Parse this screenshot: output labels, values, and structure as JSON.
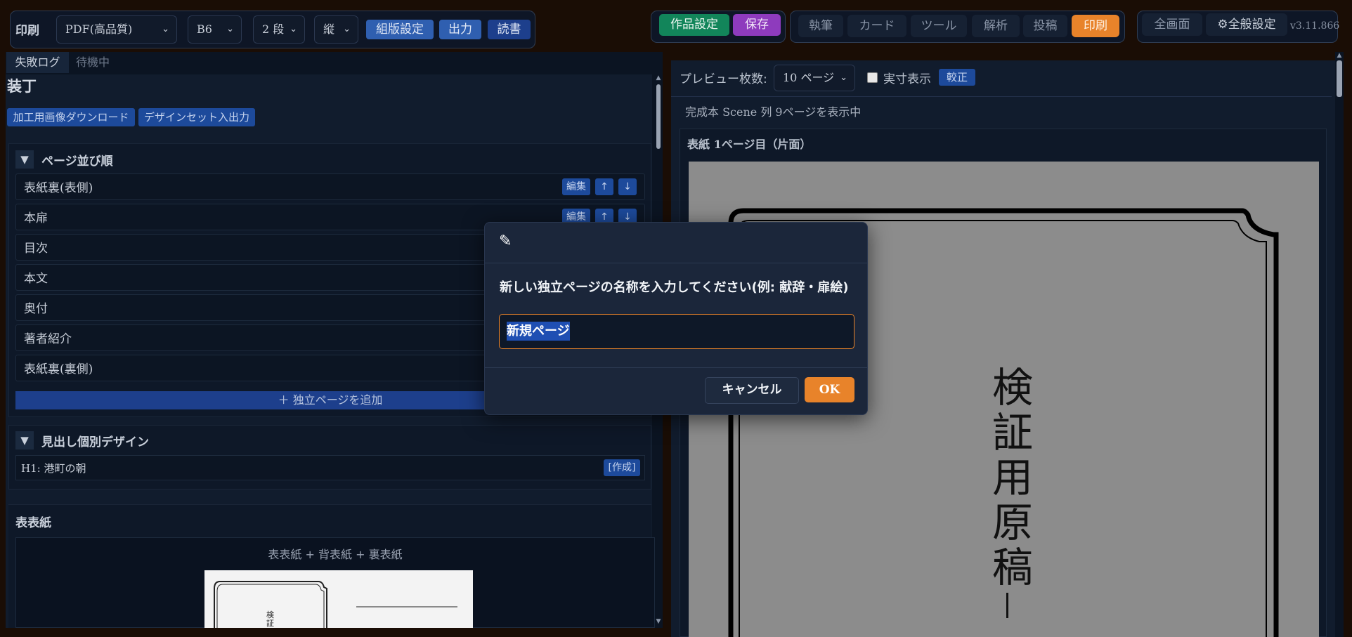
{
  "toolbar": {
    "print_label": "印刷",
    "quality": "PDF(高品質)",
    "size": "B6",
    "columns": "2 段",
    "orientation": "縦",
    "layout_button": "組版設定",
    "output_button": "出力",
    "read_button": "読書",
    "work_settings_button": "作品設定",
    "save_button": "保存",
    "tabs": [
      "執筆",
      "カード",
      "ツール",
      "解析",
      "投稿",
      "印刷"
    ],
    "fullscreen_button": "全画面",
    "global_settings_button": "⚙全般設定",
    "version": "v3.11.866"
  },
  "left": {
    "tabs": [
      "失敗ログ",
      "待機中"
    ],
    "title": "装丁",
    "actions": [
      "加工用画像ダウンロード",
      "デザインセット入出力"
    ],
    "page_order": {
      "heading": "ページ並び順",
      "items": [
        "表紙裏(表側)",
        "本扉",
        "目次",
        "本文",
        "奥付",
        "著者紹介",
        "表紙裏(裏側)"
      ],
      "edit_label": "編集",
      "up_label": "↑",
      "down_label": "↓",
      "add_button": "＋ 独立ページを追加"
    },
    "heading_design": {
      "heading": "見出し個別デザイン",
      "item": "H1: 港町の朝",
      "create_label": "[作成]"
    },
    "cover": {
      "heading": "表表紙",
      "subtitle": "表表紙 + 背表紙 + 裏表紙",
      "thumb_text": "検証"
    }
  },
  "right": {
    "preview_count_label": "プレビュー枚数:",
    "preview_count_value": "10 ページ",
    "actual_size_label": "実寸表示",
    "proof_button": "較正",
    "status": "完成本 Scene 列 9ページを表示中",
    "page_heading": "表紙 1ページ目（片面）",
    "vertical_title": [
      "検",
      "証",
      "用",
      "原",
      "稿"
    ],
    "dash": "―"
  },
  "modal": {
    "icon": "pencil-icon",
    "message": "新しい独立ページの名称を入力してください(例: 献辞・扉絵)",
    "input_value": "新規ページ",
    "cancel": "キャンセル",
    "ok": "OK"
  },
  "colors": {
    "accent_orange": "#e8832a",
    "save_purple": "#8e3bbd",
    "work_green": "#12855a",
    "button_blue": "#2f5fb0"
  }
}
